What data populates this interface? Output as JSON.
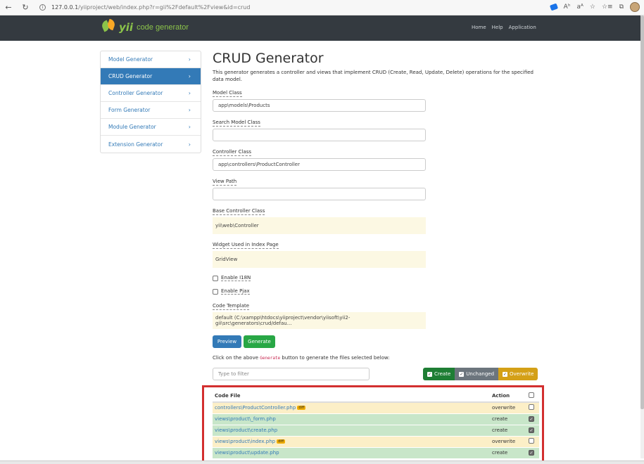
{
  "browser": {
    "url_host": "127.0.0.1",
    "url_path": "/yiiproject/web/index.php?r=gii%2Fdefault%2Fview&id=crud",
    "right_icons": [
      "Aʰ",
      "aᴬ",
      "☆",
      "☆≡",
      "⧉"
    ]
  },
  "navbar": {
    "brand_yii": "yii",
    "brand_text": "code generator",
    "links": [
      "Home",
      "Help",
      "Application"
    ]
  },
  "sidebar": {
    "items": [
      {
        "label": "Model Generator",
        "active": false
      },
      {
        "label": "CRUD Generator",
        "active": true
      },
      {
        "label": "Controller Generator",
        "active": false
      },
      {
        "label": "Form Generator",
        "active": false
      },
      {
        "label": "Module Generator",
        "active": false
      },
      {
        "label": "Extension Generator",
        "active": false
      }
    ]
  },
  "main": {
    "title": "CRUD Generator",
    "description": "This generator generates a controller and views that implement CRUD (Create, Read, Update, Delete) operations for the specified data model.",
    "fields": {
      "model_class_label": "Model Class",
      "model_class_value": "app\\models\\Products",
      "search_model_label": "Search Model Class",
      "search_model_value": "",
      "controller_class_label": "Controller Class",
      "controller_class_value": "app\\controllers\\ProductController",
      "view_path_label": "View Path",
      "view_path_value": "",
      "base_controller_label": "Base Controller Class",
      "base_controller_value": "yii\\web\\Controller",
      "widget_label": "Widget Used in Index Page",
      "widget_value": "GridView",
      "enable_i18n_label": "Enable I18N",
      "enable_pjax_label": "Enable Pjax",
      "code_template_label": "Code Template",
      "code_template_value": "default (C:\\xampp\\htdocs\\yiiproject\\vendor\\yiisoft\\yii2-gii\\src\\generators\\crud/defau..."
    },
    "preview_button": "Preview",
    "generate_button": "Generate",
    "hint_before": "Click on the above ",
    "hint_code": "Generate",
    "hint_after": " button to generate the files selected below:",
    "filter_placeholder": "Type to filter",
    "legend": {
      "create": "Create",
      "unchanged": "Unchanged",
      "overwrite": "Overwrite"
    }
  },
  "files": {
    "col_file": "Code File",
    "col_action": "Action",
    "diff_label": "diff",
    "rows": [
      {
        "path": "controllers\\ProductController.php",
        "action": "overwrite",
        "diff": true,
        "checked": false
      },
      {
        "path": "views\\product\\_form.php",
        "action": "create",
        "diff": false,
        "checked": true
      },
      {
        "path": "views\\product\\create.php",
        "action": "create",
        "diff": false,
        "checked": true
      },
      {
        "path": "views\\product\\index.php",
        "action": "overwrite",
        "diff": true,
        "checked": false
      },
      {
        "path": "views\\product\\update.php",
        "action": "create",
        "diff": false,
        "checked": true
      }
    ]
  },
  "colors": {
    "primary": "#337ab7",
    "success": "#28a745",
    "create_row": "#c8e6c9",
    "overwrite_row": "#fcefc7",
    "highlight_frame": "#d32f2f"
  }
}
